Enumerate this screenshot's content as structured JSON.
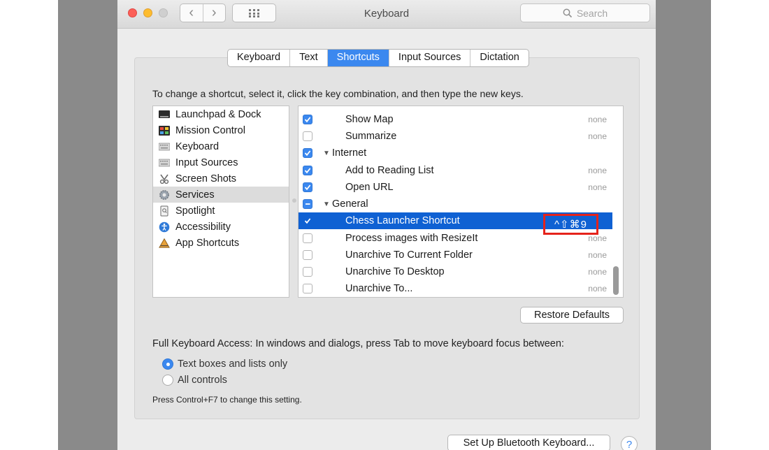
{
  "window": {
    "title": "Keyboard"
  },
  "toolbar": {
    "back_glyph": "‹",
    "forward_glyph": "›",
    "search_placeholder": "Search"
  },
  "tabs": [
    {
      "label": "Keyboard"
    },
    {
      "label": "Text"
    },
    {
      "label": "Shortcuts",
      "active": true
    },
    {
      "label": "Input Sources"
    },
    {
      "label": "Dictation"
    }
  ],
  "instructions": "To change a shortcut, select it, click the key combination, and then type the new keys.",
  "categories": [
    {
      "label": "Launchpad & Dock",
      "icon": "launchpad-dock-icon"
    },
    {
      "label": "Mission Control",
      "icon": "mission-control-icon"
    },
    {
      "label": "Keyboard",
      "icon": "keyboard-icon"
    },
    {
      "label": "Input Sources",
      "icon": "input-sources-icon"
    },
    {
      "label": "Screen Shots",
      "icon": "screen-shots-icon"
    },
    {
      "label": "Services",
      "icon": "services-gear-icon",
      "selected": true
    },
    {
      "label": "Spotlight",
      "icon": "spotlight-icon"
    },
    {
      "label": "Accessibility",
      "icon": "accessibility-icon"
    },
    {
      "label": "App Shortcuts",
      "icon": "app-shortcuts-icon"
    }
  ],
  "shortcuts": [
    {
      "label": "Show Map",
      "checked": true,
      "shortcut": "none"
    },
    {
      "label": "Summarize",
      "checked": false,
      "shortcut": "none"
    },
    {
      "group": "Internet",
      "checked": true
    },
    {
      "label": "Add to Reading List",
      "checked": true,
      "shortcut": "none"
    },
    {
      "label": "Open URL",
      "checked": true,
      "shortcut": "none"
    },
    {
      "group": "General",
      "checked": "mixed"
    },
    {
      "label": "Chess Launcher Shortcut",
      "checked": true,
      "shortcut": "^⇧⌘9",
      "selected": true
    },
    {
      "label": "Process images with ResizeIt",
      "checked": false,
      "shortcut": "none"
    },
    {
      "label": "Unarchive To Current Folder",
      "checked": false,
      "shortcut": "none"
    },
    {
      "label": "Unarchive To Desktop",
      "checked": false,
      "shortcut": "none"
    },
    {
      "label": "Unarchive To...",
      "checked": false,
      "shortcut": "none"
    }
  ],
  "buttons": {
    "restore_defaults": "Restore Defaults",
    "bluetooth": "Set Up Bluetooth Keyboard...",
    "help": "?"
  },
  "full_keyboard_access": {
    "label": "Full Keyboard Access: In windows and dialogs, press Tab to move keyboard focus between:",
    "options": [
      {
        "label": "Text boxes and lists only",
        "selected": true
      },
      {
        "label": "All controls",
        "selected": false
      }
    ],
    "hint": "Press Control+F7 to change this setting."
  },
  "colors": {
    "accent": "#3b88ef",
    "selection": "#0f61d3",
    "highlight_box": "#e5231b"
  }
}
